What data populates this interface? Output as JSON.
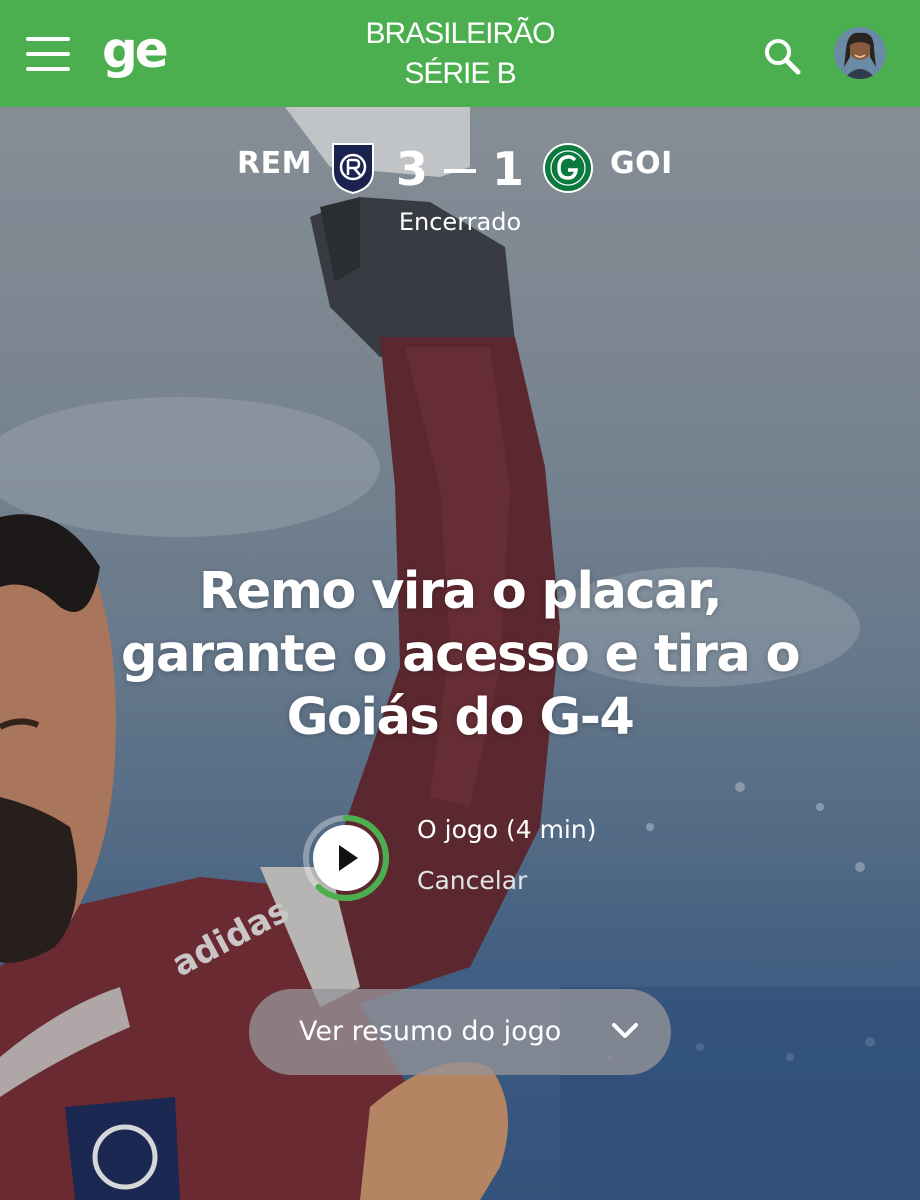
{
  "header": {
    "logo_text": "ge",
    "competition_line1": "BRASILEIRÃO",
    "competition_line2": "SÉRIE B",
    "brand_color": "#4caf4f"
  },
  "match": {
    "home_team": "REM",
    "home_score": "3",
    "away_score": "1",
    "away_team": "GOI",
    "status": "Encerrado"
  },
  "headline": "Remo vira o placar, garante o acesso e tira o Goiás do G-4",
  "video": {
    "title": "O jogo (4 min)",
    "cancel_label": "Cancelar",
    "progress": 0.62
  },
  "summary_button": {
    "label": "Ver resumo do jogo"
  },
  "icons": [
    "menu-icon",
    "search-icon",
    "avatar",
    "remo-crest-icon",
    "goias-crest-icon",
    "play-icon",
    "chevron-down-icon"
  ]
}
